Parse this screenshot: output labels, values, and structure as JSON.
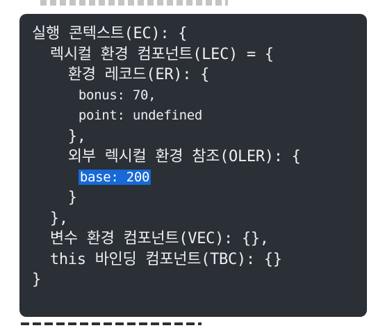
{
  "code": {
    "lines": [
      {
        "indent": "",
        "text": "실행 콘텍스트(EC): {"
      },
      {
        "indent": "  ",
        "text": "렉시컬 환경 컴포넌트(LEC) = {"
      },
      {
        "indent": "    ",
        "text": "환경 레코드(ER): {"
      },
      {
        "indent": "      ",
        "text": "bonus: 70,"
      },
      {
        "indent": "      ",
        "text": "point: undefined"
      },
      {
        "indent": "    ",
        "text": "},"
      },
      {
        "indent": "    ",
        "text": "외부 렉시컬 환경 참조(OLER): {"
      },
      {
        "indent": "      ",
        "text": "base: 200"
      },
      {
        "indent": "    ",
        "text": "}"
      },
      {
        "indent": "  ",
        "text": "},"
      },
      {
        "indent": "  ",
        "text": "변수 환경 컴포넌트(VEC): {},"
      },
      {
        "indent": "  ",
        "text": "this 바인딩 컴포넌트(TBC): {}"
      },
      {
        "indent": "",
        "text": "}"
      }
    ],
    "highlighted_text": "base: 200"
  },
  "colors": {
    "panel_background": "#2b2f36",
    "text": "#eceff3",
    "selection": "#1769d6"
  }
}
